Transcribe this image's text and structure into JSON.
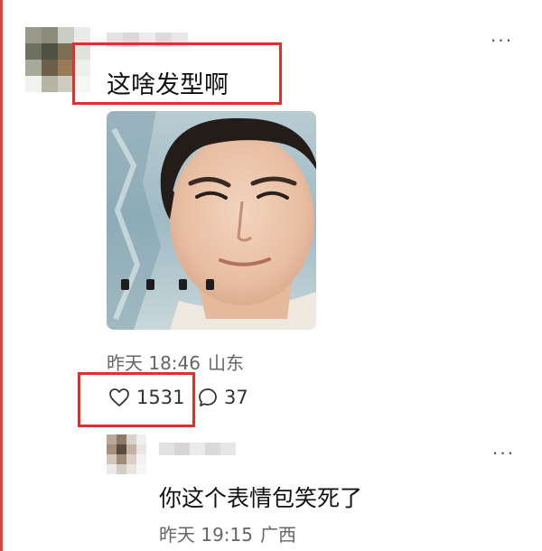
{
  "colors": {
    "highlight_border": "#e0302d",
    "edge_strip": "#d8473c",
    "meta_text": "#666666"
  },
  "comment": {
    "text": "这啥发型啊",
    "image_icon": "face-photo",
    "meta": {
      "time": "昨天 18:46",
      "location": "山东"
    },
    "likes": "1531",
    "replies": "37",
    "more_icon": "more-dots-icon"
  },
  "reply": {
    "text": "你这个表情包笑死了",
    "meta": {
      "time": "昨天 19:15",
      "location": "广西"
    },
    "more_icon": "more-dots-icon"
  }
}
